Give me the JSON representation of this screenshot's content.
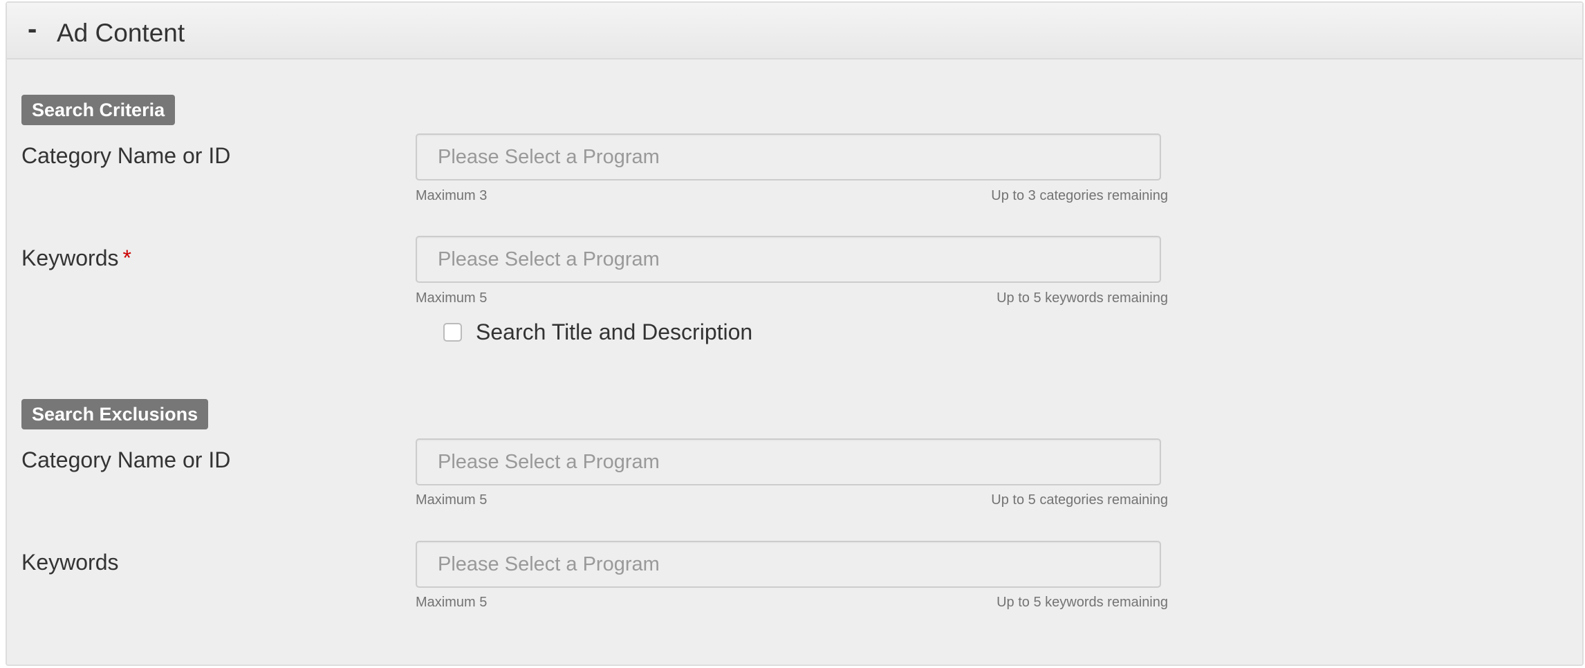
{
  "panel": {
    "toggle_symbol": "-",
    "title": "Ad Content"
  },
  "search_criteria": {
    "label": "Search Criteria",
    "category": {
      "label": "Category Name or ID",
      "placeholder": "Please Select a Program",
      "help_max": "Maximum 3",
      "help_remaining": "Up to 3 categories remaining"
    },
    "keywords": {
      "label": "Keywords",
      "required_marker": "*",
      "placeholder": "Please Select a Program",
      "help_max": "Maximum 5",
      "help_remaining": "Up to 5 keywords remaining"
    },
    "search_title_description": {
      "label": "Search Title and Description",
      "checked": false
    }
  },
  "search_exclusions": {
    "label": "Search Exclusions",
    "category": {
      "label": "Category Name or ID",
      "placeholder": "Please Select a Program",
      "help_max": "Maximum 5",
      "help_remaining": "Up to 5 categories remaining"
    },
    "keywords": {
      "label": "Keywords",
      "placeholder": "Please Select a Program",
      "help_max": "Maximum 5",
      "help_remaining": "Up to 5 keywords remaining"
    }
  },
  "colors": {
    "panel_background": "#eeeeee",
    "label_badge": "#777777",
    "required": "#cc0000",
    "help_text": "#737373",
    "placeholder": "#999999"
  }
}
